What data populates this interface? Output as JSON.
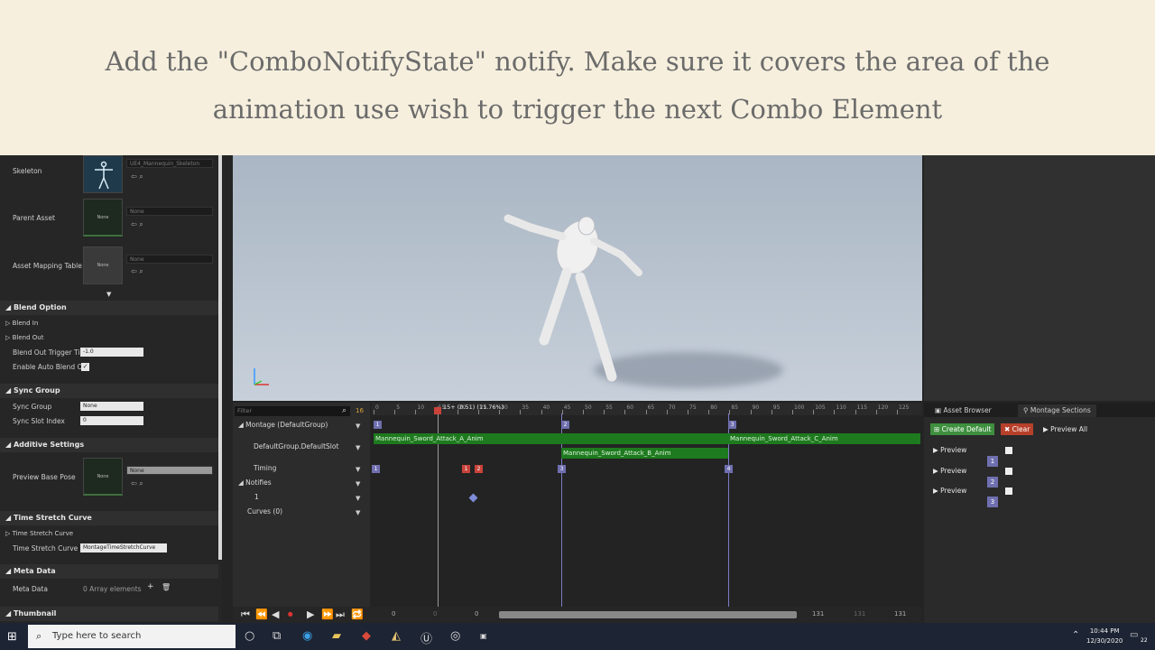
{
  "caption": {
    "line1": "Add the \"ComboNotifyState\" notify. Make sure it covers the area of the",
    "line2": "animation use wish to trigger the next Combo Element"
  },
  "details": {
    "skeleton_label": "Skeleton",
    "skeleton_value": "UE4_Mannequin_Skeleton",
    "parent_asset_label": "Parent Asset",
    "parent_asset_value": "None",
    "thumb_none": "None",
    "asset_mapping_label": "Asset Mapping Table",
    "asset_mapping_value": "None",
    "blend_option": "Blend Option",
    "blend_in": "Blend In",
    "blend_out": "Blend Out",
    "blend_out_trigger_label": "Blend Out Trigger Tim",
    "blend_out_trigger_value": "-1.0",
    "enable_auto_blend_label": "Enable Auto Blend Ou",
    "sync_group": "Sync Group",
    "sync_group_label": "Sync Group",
    "sync_group_value": "None",
    "sync_slot_label": "Sync Slot Index",
    "sync_slot_value": "0",
    "additive_settings": "Additive Settings",
    "preview_base_pose_label": "Preview Base Pose",
    "preview_base_pose_value": "None",
    "time_stretch_curve_section": "Time Stretch Curve",
    "time_stretch_curve_sub": "Time Stretch Curve",
    "time_stretch_curve_name_label": "Time Stretch Curve N",
    "time_stretch_curve_name_value": "MontageTimeStretchCurve",
    "meta_data": "Meta Data",
    "meta_data_label": "Meta Data",
    "meta_data_value": "0 Array elements",
    "thumbnail": "Thumbnail"
  },
  "timeline": {
    "filter_placeholder": "Filter",
    "frame_counter": "16",
    "montage_group": "Montage (DefaultGroup)",
    "default_slot": "DefaultGroup.DefaultSlot",
    "timing": "Timing",
    "notifies": "Notifies",
    "notify_track": "1",
    "curves": "Curves",
    "curves_count": "(0)",
    "playhead_label": "15+ (0.51) (11.76%)",
    "ruler_labels": [
      "0",
      "5",
      "10",
      "15",
      "20",
      "25",
      "30",
      "35",
      "40",
      "45",
      "50",
      "55",
      "60",
      "65",
      "70",
      "75",
      "80",
      "85",
      "90",
      "95",
      "100",
      "105",
      "110",
      "115",
      "120",
      "125"
    ],
    "segments": [
      {
        "label": "Mannequin_Sword_Attack_A_Anim"
      },
      {
        "label": "Mannequin_Sword_Attack_B_Anim"
      },
      {
        "label": "Mannequin_Sword_Attack_C_Anim"
      }
    ],
    "section_markers": [
      "1",
      "2",
      "3"
    ],
    "timing_markers": [
      "1",
      "1",
      "2",
      "3",
      "4"
    ],
    "transport_numbers": [
      "0",
      "0",
      "0",
      "131",
      "131",
      "131"
    ]
  },
  "sections_panel": {
    "tab_asset_browser": "Asset Browser",
    "tab_montage_sections": "Montage Sections",
    "create_default": "Create Default",
    "clear": "Clear",
    "preview_all": "Preview All",
    "preview_label": "Preview",
    "rows": [
      "1",
      "2",
      "3"
    ]
  },
  "taskbar": {
    "search_placeholder": "Type here to search",
    "time": "10:44 PM",
    "date": "12/30/2020",
    "notification_count": "22"
  },
  "colors": {
    "caption_bg": "#f6efdd",
    "segment_green": "#1e7a1e",
    "marker_purple": "#6f6fb0",
    "marker_red": "#c9433a",
    "create_default_green": "#3e8f3e",
    "clear_red": "#b7402b"
  }
}
